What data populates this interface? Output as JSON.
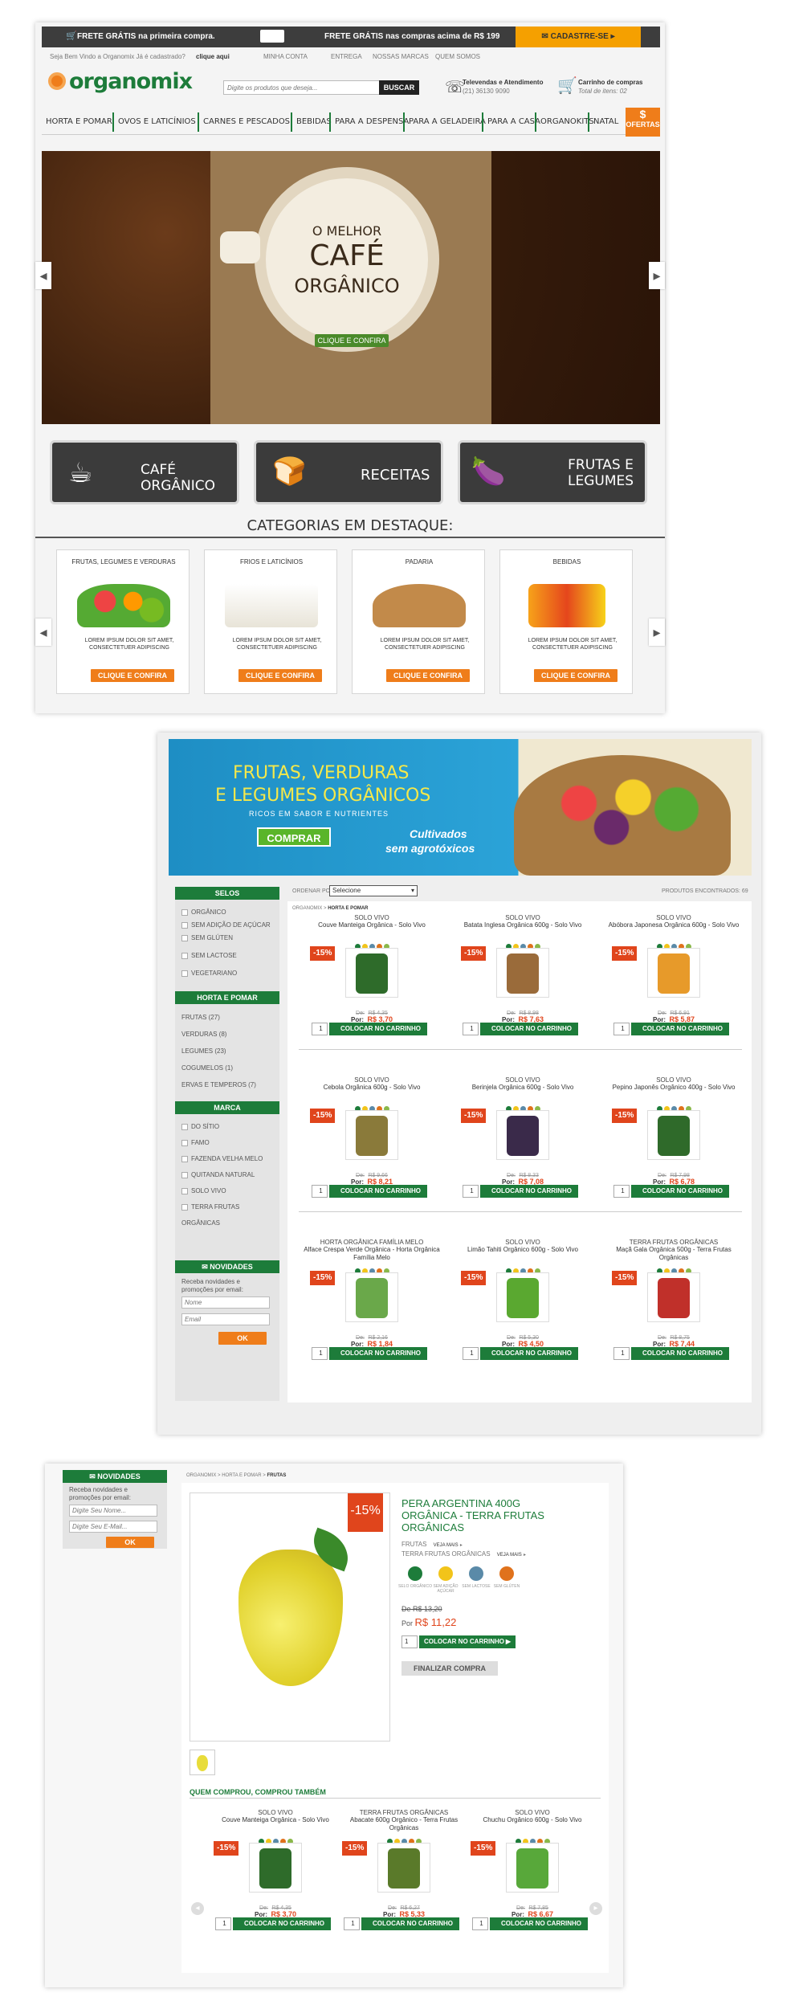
{
  "topbar": {
    "free1": "FRETE GRÁTIS na primeira compra.",
    "free2": "FRETE GRÁTIS nas compras acima de R$ 199",
    "signup": "CADASTRE-SE"
  },
  "subbar": {
    "welcome": "Seja Bem Vindo a Organomix Já é cadastrado?",
    "login": "clique aqui",
    "account": "MINHA CONTA",
    "delivery": "ENTREGA",
    "brands": "NOSSAS MARCAS",
    "about": "QUEM SOMOS"
  },
  "header": {
    "logo": "organomix",
    "search_placeholder": "Digite os produtos que deseja...",
    "search_btn": "BUSCAR",
    "phone_title": "Televendas e Atendimento",
    "phone": "(21) 36130 9090",
    "cart_title": "Carrinho de compras",
    "cart_total": "Total de itens: 02"
  },
  "nav": [
    "HORTA E POMAR",
    "OVOS E LATICÍNIOS",
    "CARNES E PESCADOS",
    "BEBIDAS",
    "PARA A DESPENSA",
    "PARA A GELADEIRA",
    "PARA A CASA",
    "ORGANOKITS",
    "NATAL"
  ],
  "nav_offers": {
    "symbol": "$",
    "label": "OFERTAS"
  },
  "hero": {
    "line1": "O MELHOR",
    "line2": "CAFÉ",
    "line3": "ORGÂNICO",
    "cta": "CLIQUE E CONFIRA"
  },
  "promos": [
    {
      "label": "CAFÉ ORGÂNICO"
    },
    {
      "label": "RECEITAS"
    },
    {
      "label": "FRUTAS E LEGUMES"
    }
  ],
  "featured": {
    "title": "CATEGORIAS EM DESTAQUE:",
    "cta": "CLIQUE E CONFIRA",
    "desc": "LOREM IPSUM DOLOR SIT AMET, CONSECTETUER ADIPISCING",
    "items": [
      "FRUTAS, LEGUMES E VERDURAS",
      "FRIOS E LATICÍNIOS",
      "PADARIA",
      "BEBIDAS"
    ]
  },
  "banner2": {
    "l1": "FRUTAS, VERDURAS",
    "l2": "E LEGUMES ORGÂNICOS",
    "sub": "RICOS EM SABOR E NUTRIENTES",
    "btn": "COMPRAR",
    "tag1": "Cultivados",
    "tag2": "sem agrotóxicos"
  },
  "listing": {
    "order_label": "ORDENAR POR",
    "order_value": "Selecione",
    "found": "PRODUTOS ENCONTRADOS: 69",
    "crumb": "ORGANOMIX >",
    "crumb_cur": "HORTA E POMAR",
    "seals_title": "SELOS",
    "seals": [
      "ORGÂNICO",
      "SEM ADIÇÃO DE AÇÚCAR",
      "SEM GLÚTEN",
      "SEM LACTOSE",
      "VEGETARIANO"
    ],
    "cat_title": "HORTA E POMAR",
    "cats": [
      "FRUTAS (27)",
      "VERDURAS (8)",
      "LEGUMES (23)",
      "COGUMELOS (1)",
      "ERVAS E TEMPEROS (7)"
    ],
    "brand_title": "MARCA",
    "brands": [
      "DO SÍTIO",
      "FAMO",
      "FAZENDA VELHA MELO",
      "QUITANDA NATURAL",
      "SOLO VIVO",
      "TERRA FRUTAS ORGÂNICAS"
    ],
    "news_title": "NOVIDADES",
    "news_text": "Receba novidades e promoções por email:",
    "news_name": "Nome",
    "news_email": "Email",
    "news_ok": "OK",
    "cart_btn": "COLOCAR NO CARRINHO",
    "old_prefix": "De:",
    "now_prefix": "Por:",
    "products": [
      {
        "brand": "SOLO VIVO",
        "name": "Couve Manteiga Orgânica - Solo Vivo",
        "old": "R$ 4,35",
        "now": "R$ 3,70",
        "disc": "-15%",
        "color": "#2e6b2a"
      },
      {
        "brand": "SOLO VIVO",
        "name": "Batata Inglesa Orgânica 600g - Solo Vivo",
        "old": "R$ 8,98",
        "now": "R$ 7,63",
        "disc": "-15%",
        "color": "#9a6b3a"
      },
      {
        "brand": "SOLO VIVO",
        "name": "Abóbora Japonesa Orgânica 600g - Solo Vivo",
        "old": "R$ 6,91",
        "now": "R$ 5,87",
        "disc": "-15%",
        "color": "#e79a2a"
      },
      {
        "brand": "SOLO VIVO",
        "name": "Cebola Orgânica 600g - Solo Vivo",
        "old": "R$ 9,66",
        "now": "R$ 8,21",
        "disc": "-15%",
        "color": "#8a7a3a"
      },
      {
        "brand": "SOLO VIVO",
        "name": "Berinjela Orgânica 600g - Solo Vivo",
        "old": "R$ 8,33",
        "now": "R$ 7,08",
        "disc": "-15%",
        "color": "#3a2a4a"
      },
      {
        "brand": "SOLO VIVO",
        "name": "Pepino Japonês Orgânico 400g - Solo Vivo",
        "old": "R$ 7,98",
        "now": "R$ 6,78",
        "disc": "-15%",
        "color": "#2f6a2a"
      },
      {
        "brand": "HORTA ORGÂNICA FAMÍLIA MELO",
        "name": "Alface Crespa Verde Orgânica - Horta Orgânica Família Melo",
        "old": "R$ 2,16",
        "now": "R$ 1,84",
        "disc": "-15%",
        "color": "#6aa84a"
      },
      {
        "brand": "SOLO VIVO",
        "name": "Limão Tahiti Orgânico 600g - Solo Vivo",
        "old": "R$ 5,30",
        "now": "R$ 4,50",
        "disc": "-15%",
        "color": "#5aa830"
      },
      {
        "brand": "TERRA FRUTAS ORGÂNICAS",
        "name": "Maçã Gala Orgânica 500g - Terra Frutas Orgânicas",
        "old": "R$ 8,75",
        "now": "R$ 7,44",
        "disc": "-15%",
        "color": "#c0302a"
      }
    ]
  },
  "detail": {
    "news_title": "NOVIDADES",
    "news_text": "Receba novidades e promoções por email:",
    "news_name": "Digite Seu Nome...",
    "news_email": "Digite Seu E-Mail...",
    "news_ok": "OK",
    "crumb1": "ORGANOMIX >",
    "crumb2": "HORTA E POMAR >",
    "crumb3": "FRUTAS",
    "disc": "-15%",
    "title": "PERA ARGENTINA 400G ORGÂNICA - TERRA FRUTAS ORGÂNICAS",
    "cat": "FRUTAS",
    "brand": "TERRA FRUTAS ORGÂNICAS",
    "see_more": "VEJA MAIS",
    "seals": [
      "SELO ORGÂNICO",
      "SEM ADIÇÃO AÇÚCAR",
      "SEM LACTOSE",
      "SEM GLÚTEN"
    ],
    "old": "De R$ 13,20",
    "now_prefix": "Por",
    "now": "R$ 11,22",
    "qty": "1",
    "cart_btn": "COLOCAR NO CARRINHO",
    "checkout": "FINALIZAR COMPRA",
    "also_title": "QUEM COMPROU, COMPROU TAMBÉM",
    "also": [
      {
        "brand": "SOLO VIVO",
        "name": "Couve Manteiga Orgânica - Solo Vivo",
        "old": "R$ 4,35",
        "now": "R$ 3,70",
        "disc": "-15%",
        "color": "#2e6b2a"
      },
      {
        "brand": "TERRA FRUTAS ORGÂNICAS",
        "name": "Abacate 600g Orgânico - Terra Frutas Orgânicas",
        "old": "R$ 6,27",
        "now": "R$ 5,33",
        "disc": "-15%",
        "color": "#5a7a2a"
      },
      {
        "brand": "SOLO VIVO",
        "name": "Chuchu Orgânico 600g - Solo Vivo",
        "old": "R$ 7,85",
        "now": "R$ 6,67",
        "disc": "-15%",
        "color": "#58a83a"
      }
    ]
  },
  "colors": {
    "green": "#1d7c3a",
    "orange": "#ef7d1a",
    "red": "#e0451c",
    "dark": "#3b3b3b"
  }
}
